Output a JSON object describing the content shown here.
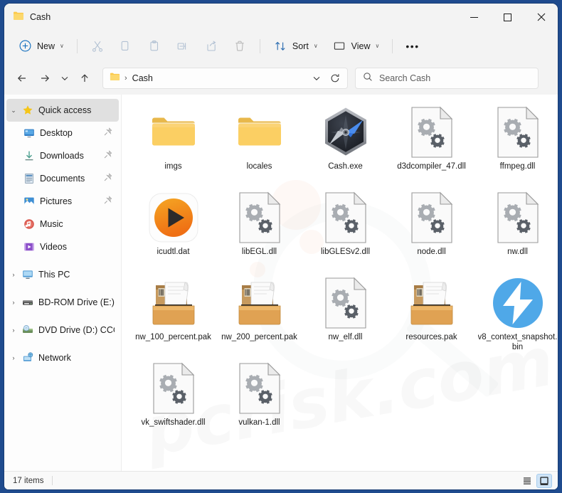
{
  "window": {
    "title": "Cash",
    "folder_icon": "folder-icon",
    "minimize_label": "─",
    "maximize_label": "☐",
    "close_label": "✕"
  },
  "toolbar": {
    "new_label": "New",
    "new_icon": "plus-circle-icon",
    "cut_icon": "scissors-icon",
    "copy_icon": "copy-icon",
    "paste_icon": "clipboard-icon",
    "rename_icon": "rename-icon",
    "share_icon": "share-icon",
    "delete_icon": "trash-icon",
    "sort_label": "Sort",
    "sort_icon": "sort-arrows-icon",
    "view_label": "View",
    "view_icon": "monitor-icon",
    "more_label": "•••",
    "chevron": "∨"
  },
  "address": {
    "back_icon": "arrow-left-icon",
    "forward_icon": "arrow-right-icon",
    "recent_icon": "chevron-down-icon",
    "up_icon": "arrow-up-icon",
    "crumb_folder_icon": "folder-icon",
    "crumb_separator": "›",
    "crumb_label": "Cash",
    "crumb_chevron": "∨",
    "refresh_icon": "refresh-icon",
    "search_icon": "search-icon",
    "search_placeholder": "Search Cash",
    "search_value": ""
  },
  "sidebar": {
    "items": [
      {
        "label": "Quick access",
        "icon": "star-icon",
        "expander": "⌄",
        "level": 0,
        "selected": true,
        "pinned": false
      },
      {
        "label": "Desktop",
        "icon": "desktop-icon",
        "expander": "",
        "level": 1,
        "selected": false,
        "pinned": true
      },
      {
        "label": "Downloads",
        "icon": "download-icon",
        "expander": "",
        "level": 1,
        "selected": false,
        "pinned": true
      },
      {
        "label": "Documents",
        "icon": "documents-icon",
        "expander": "",
        "level": 1,
        "selected": false,
        "pinned": true
      },
      {
        "label": "Pictures",
        "icon": "pictures-icon",
        "expander": "",
        "level": 1,
        "selected": false,
        "pinned": true
      },
      {
        "label": "Music",
        "icon": "music-icon",
        "expander": "",
        "level": 1,
        "selected": false,
        "pinned": false
      },
      {
        "label": "Videos",
        "icon": "videos-icon",
        "expander": "",
        "level": 1,
        "selected": false,
        "pinned": false
      },
      {
        "label": "This PC",
        "icon": "this-pc-icon",
        "expander": "›",
        "level": 0,
        "selected": false,
        "pinned": false
      },
      {
        "label": "BD-ROM Drive (E:) C",
        "icon": "bd-rom-icon",
        "expander": "›",
        "level": 0,
        "selected": false,
        "pinned": false
      },
      {
        "label": "DVD Drive (D:) CCCC",
        "icon": "dvd-drive-icon",
        "expander": "›",
        "level": 0,
        "selected": false,
        "pinned": false
      },
      {
        "label": "Network",
        "icon": "network-icon",
        "expander": "›",
        "level": 0,
        "selected": false,
        "pinned": false
      }
    ]
  },
  "files": [
    {
      "name": "imgs",
      "icon": "folder-icon"
    },
    {
      "name": "locales",
      "icon": "folder-icon"
    },
    {
      "name": "Cash.exe",
      "icon": "hexagon-compass-icon"
    },
    {
      "name": "d3dcompiler_47.dll",
      "icon": "dll-gears-icon"
    },
    {
      "name": "ffmpeg.dll",
      "icon": "dll-gears-icon"
    },
    {
      "name": "icudtl.dat",
      "icon": "orange-play-icon"
    },
    {
      "name": "libEGL.dll",
      "icon": "dll-gears-icon"
    },
    {
      "name": "libGLESv2.dll",
      "icon": "dll-gears-icon"
    },
    {
      "name": "node.dll",
      "icon": "dll-gears-icon"
    },
    {
      "name": "nw.dll",
      "icon": "dll-gears-icon"
    },
    {
      "name": "nw_100_percent.pak",
      "icon": "package-box-icon"
    },
    {
      "name": "nw_200_percent.pak",
      "icon": "package-box-icon"
    },
    {
      "name": "nw_elf.dll",
      "icon": "dll-gears-icon"
    },
    {
      "name": "resources.pak",
      "icon": "package-box-icon"
    },
    {
      "name": "v8_context_snapshot.bin",
      "icon": "blue-bolt-icon"
    },
    {
      "name": "vk_swiftshader.dll",
      "icon": "dll-gears-icon"
    },
    {
      "name": "vulkan-1.dll",
      "icon": "dll-gears-icon"
    }
  ],
  "statusbar": {
    "item_count": "17 items",
    "details_view_icon": "details-view-icon",
    "large_icons_view_icon": "large-icons-view-icon"
  },
  "watermark": {
    "text": "pcrisk.com"
  },
  "colors": {
    "accent": "#0f6cbd",
    "desktop": "#1f4b8e",
    "chrome": "#f3f3f3",
    "folder_yellow": "#fbd16b",
    "bolt_blue": "#4aa8e8",
    "play_orange": "#f08a1c"
  }
}
